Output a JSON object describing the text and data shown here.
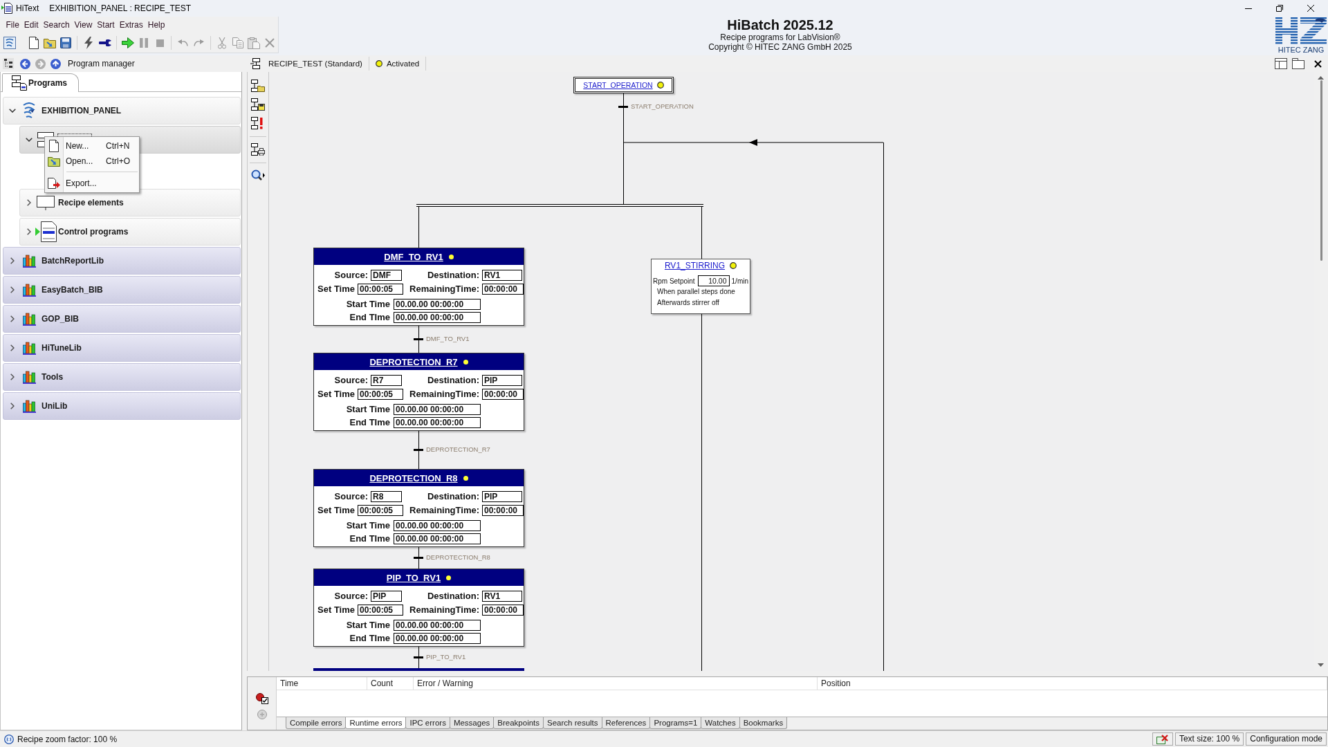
{
  "window": {
    "app_name": "HiText",
    "title": "EXHIBITION_PANEL : RECIPE_TEST"
  },
  "menu_bar": [
    "File",
    "Edit",
    "Search",
    "View",
    "Start",
    "Extras",
    "Help"
  ],
  "toolbar": [
    {
      "kind": "home",
      "disabled": false
    },
    {
      "kind": "new",
      "disabled": false
    },
    {
      "kind": "open",
      "disabled": false
    },
    {
      "kind": "save",
      "disabled": false
    },
    {
      "kind": "separator"
    },
    {
      "kind": "compile",
      "disabled": false
    },
    {
      "kind": "tool",
      "disabled": false
    },
    {
      "kind": "separator"
    },
    {
      "kind": "run",
      "disabled": false
    },
    {
      "kind": "pause",
      "disabled": true
    },
    {
      "kind": "stop",
      "disabled": true
    },
    {
      "kind": "separator"
    },
    {
      "kind": "undo",
      "disabled": true
    },
    {
      "kind": "redo",
      "disabled": true
    },
    {
      "kind": "separator"
    },
    {
      "kind": "cut",
      "disabled": true
    },
    {
      "kind": "copy",
      "disabled": true
    },
    {
      "kind": "paste",
      "disabled": true
    },
    {
      "kind": "delete",
      "disabled": true
    }
  ],
  "brand": {
    "title": "HiBatch 2025.12",
    "subtitle": "Recipe programs for LabVision®",
    "copyright": "Copyright © HITEC ZANG GmbH 2025",
    "logo_text": "HITEC ZANG"
  },
  "program_manager": {
    "title": "Program manager",
    "navigation": [
      {
        "kind": "back",
        "disabled": false
      },
      {
        "kind": "forward",
        "disabled": true
      },
      {
        "kind": "up",
        "disabled": false
      }
    ],
    "tabs": [
      {
        "label": "Programs",
        "selected": true
      }
    ],
    "tree": [
      {
        "label": "EXHIBITION_PANEL",
        "kind": "project",
        "expanded": true,
        "selected": false,
        "children": [
          {
            "kind": "recipe_folder",
            "expanded": true,
            "selected": true
          },
          {
            "label": "Recipe elements",
            "kind": "recipe_elements",
            "expanded": false,
            "selected": false
          },
          {
            "label": "Control programs",
            "kind": "control_programs",
            "expanded": false,
            "selected": false
          }
        ]
      },
      {
        "label": "BatchReportLib",
        "kind": "library",
        "expanded": false,
        "selected": false
      },
      {
        "label": "EasyBatch_BIB",
        "kind": "library",
        "expanded": false,
        "selected": false
      },
      {
        "label": "GOP_BIB",
        "kind": "library",
        "expanded": false,
        "selected": false
      },
      {
        "label": "HiTuneLib",
        "kind": "library",
        "expanded": false,
        "selected": false
      },
      {
        "label": "Tools",
        "kind": "library",
        "expanded": false,
        "selected": false
      },
      {
        "label": "UniLib",
        "kind": "library",
        "expanded": false,
        "selected": false
      }
    ],
    "context_menu": [
      {
        "kind": "new",
        "label": "New...",
        "shortcut": "Ctrl+N"
      },
      {
        "kind": "open",
        "label": "Open...",
        "shortcut": "Ctrl+O"
      },
      {
        "kind": "separator"
      },
      {
        "kind": "export",
        "label": "Export..."
      }
    ]
  },
  "recipe": {
    "name": "RECIPE_TEST (Standard)",
    "status": "Activated",
    "diagram": {
      "start_step": {
        "name": "START_OPERATION",
        "transition": "START_OPERATION"
      },
      "steps": [
        {
          "kind": "transfer",
          "name": "DMF_TO_RV1",
          "fields": [
            {
              "label": "Source:",
              "value": "DMF"
            },
            {
              "label": "Destination:",
              "value": "RV1"
            },
            {
              "label": "Set Time",
              "value": "00:00:05"
            },
            {
              "label": "RemainingTime:",
              "value": "00:00:00"
            },
            {
              "label": "Start Time",
              "value": "00.00.00 00:00:00"
            },
            {
              "label": "End TIme",
              "value": "00.00.00 00:00:00"
            }
          ],
          "transition": "DMF_TO_RV1"
        },
        {
          "kind": "transfer",
          "name": "DEPROTECTION_R7",
          "fields": [
            {
              "label": "Source:",
              "value": "R7"
            },
            {
              "label": "Destination:",
              "value": "PIP"
            },
            {
              "label": "Set Time",
              "value": "00:00:05"
            },
            {
              "label": "RemainingTime:",
              "value": "00:00:00"
            },
            {
              "label": "Start Time",
              "value": "00.00.00 00:00:00"
            },
            {
              "label": "End TIme",
              "value": "00.00.00 00:00:00"
            }
          ],
          "transition": "DEPROTECTION_R7"
        },
        {
          "kind": "transfer",
          "name": "DEPROTECTION_R8",
          "fields": [
            {
              "label": "Source:",
              "value": "R8"
            },
            {
              "label": "Destination:",
              "value": "PIP"
            },
            {
              "label": "Set Time",
              "value": "00:00:05"
            },
            {
              "label": "RemainingTime:",
              "value": "00:00:00"
            },
            {
              "label": "Start Time",
              "value": "00.00.00 00:00:00"
            },
            {
              "label": "End TIme",
              "value": "00.00.00 00:00:00"
            }
          ],
          "transition": "DEPROTECTION_R8"
        },
        {
          "kind": "transfer",
          "name": "PIP_TO_RV1",
          "fields": [
            {
              "label": "Source:",
              "value": "PIP"
            },
            {
              "label": "Destination:",
              "value": "RV1"
            },
            {
              "label": "Set Time",
              "value": "00:00:05"
            },
            {
              "label": "RemainingTime:",
              "value": "00:00:00"
            },
            {
              "label": "Start Time",
              "value": "00.00.00 00:00:00"
            },
            {
              "label": "End TIme",
              "value": "00.00.00 00:00:00"
            }
          ],
          "transition": "PIP_TO_RV1"
        },
        {
          "kind": "cut_off"
        }
      ],
      "parallel_step": {
        "name": "RV1_STIRRING",
        "setpoint_label": "Rpm Setpoint",
        "setpoint": "10.00",
        "unit": "1/min",
        "notes": [
          "When parallel steps done",
          "Afterwards stirrer off"
        ]
      }
    }
  },
  "messages": {
    "columns": [
      "Time",
      "Count",
      "Error / Warning",
      "Position"
    ],
    "tabs": [
      {
        "label": "Compile errors",
        "selected": false
      },
      {
        "label": "Runtime errors",
        "selected": true
      },
      {
        "label": "IPC errors",
        "selected": false
      },
      {
        "label": "Messages",
        "selected": false
      },
      {
        "label": "Breakpoints",
        "selected": false
      },
      {
        "label": "Search results",
        "selected": false
      },
      {
        "label": "References",
        "selected": false
      },
      {
        "label": "Programs=1",
        "selected": false
      },
      {
        "label": "Watches",
        "selected": false
      },
      {
        "label": "Bookmarks",
        "selected": false
      }
    ]
  },
  "status_bar": {
    "zoom": "Recipe zoom factor: 100 %",
    "text_size": "Text size: 100 %",
    "mode": "Configuration mode"
  }
}
